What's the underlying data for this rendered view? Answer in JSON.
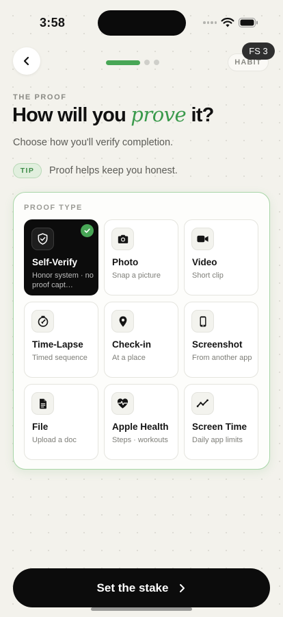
{
  "status_bar": {
    "time": "3:58"
  },
  "header": {
    "badge": "FS 3",
    "mode_chip": "HABIT",
    "progress_step": 1,
    "progress_total": 3
  },
  "intro": {
    "eyebrow": "THE PROOF",
    "title_before": "How will you ",
    "title_accent": "prove",
    "title_after": " it?",
    "subtitle": "Choose how you'll verify completion.",
    "tip_label": "TIP",
    "tip_text": "Proof helps keep you honest."
  },
  "proof_card": {
    "label": "PROOF TYPE",
    "options": [
      {
        "title": "Self-Verify",
        "subtitle": "Honor system · no proof capt…",
        "icon": "shield-check-icon",
        "selected": true
      },
      {
        "title": "Photo",
        "subtitle": "Snap a picture",
        "icon": "camera-icon",
        "selected": false
      },
      {
        "title": "Video",
        "subtitle": "Short clip",
        "icon": "video-camera-icon",
        "selected": false
      },
      {
        "title": "Time-Lapse",
        "subtitle": "Timed sequence",
        "icon": "timer-icon",
        "selected": false
      },
      {
        "title": "Check-in",
        "subtitle": "At a place",
        "icon": "location-pin-icon",
        "selected": false
      },
      {
        "title": "Screenshot",
        "subtitle": "From another app",
        "icon": "phone-icon",
        "selected": false
      },
      {
        "title": "File",
        "subtitle": "Upload a doc",
        "icon": "document-icon",
        "selected": false
      },
      {
        "title": "Apple Health",
        "subtitle": "Steps · workouts",
        "icon": "heart-pulse-icon",
        "selected": false
      },
      {
        "title": "Screen Time",
        "subtitle": "Daily app limits",
        "icon": "trend-line-icon",
        "selected": false
      }
    ]
  },
  "cta": {
    "label": "Set the stake"
  },
  "colors": {
    "accent": "#48a656",
    "background": "#f3f2ec",
    "selected_tile": "#0c0c0c"
  }
}
